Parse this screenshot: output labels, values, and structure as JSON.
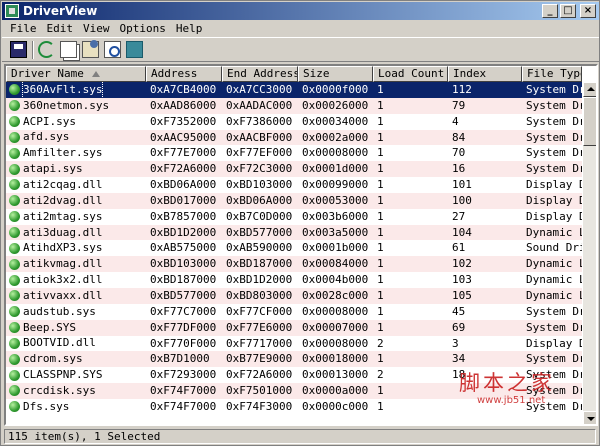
{
  "window": {
    "title": "DriverView"
  },
  "menu": [
    "File",
    "Edit",
    "View",
    "Options",
    "Help"
  ],
  "toolbar": {
    "buttons": [
      {
        "name": "save-icon"
      },
      {
        "name": "refresh-icon"
      },
      {
        "name": "copy-icon"
      },
      {
        "name": "properties-icon"
      },
      {
        "name": "find-icon"
      },
      {
        "name": "exit-icon"
      }
    ]
  },
  "columns": [
    "Driver Name",
    "Address",
    "End Address",
    "Size",
    "Load Count",
    "Index",
    "File Type"
  ],
  "rows": [
    {
      "name": "360AvFlt.sys",
      "address": "0xA7CB4000",
      "end": "0xA7CC3000",
      "size": "0x0000f000",
      "load": "1",
      "index": "112",
      "type": "System Dri",
      "selected": true
    },
    {
      "name": "360netmon.sys",
      "address": "0xAAD86000",
      "end": "0xAADAC000",
      "size": "0x00026000",
      "load": "1",
      "index": "79",
      "type": "System Dri"
    },
    {
      "name": "ACPI.sys",
      "address": "0xF7352000",
      "end": "0xF7386000",
      "size": "0x00034000",
      "load": "1",
      "index": "4",
      "type": "System Dri"
    },
    {
      "name": "afd.sys",
      "address": "0xAAC95000",
      "end": "0xAACBF000",
      "size": "0x0002a000",
      "load": "1",
      "index": "84",
      "type": "System Dri"
    },
    {
      "name": "Amfilter.sys",
      "address": "0xF77E7000",
      "end": "0xF77EF000",
      "size": "0x00008000",
      "load": "1",
      "index": "70",
      "type": "System Dri"
    },
    {
      "name": "atapi.sys",
      "address": "0xF72A6000",
      "end": "0xF72C3000",
      "size": "0x0001d000",
      "load": "1",
      "index": "16",
      "type": "System Dri"
    },
    {
      "name": "ati2cqag.dll",
      "address": "0xBD06A000",
      "end": "0xBD103000",
      "size": "0x00099000",
      "load": "1",
      "index": "101",
      "type": "Display Dr"
    },
    {
      "name": "ati2dvag.dll",
      "address": "0xBD017000",
      "end": "0xBD06A000",
      "size": "0x00053000",
      "load": "1",
      "index": "100",
      "type": "Display Dr"
    },
    {
      "name": "ati2mtag.sys",
      "address": "0xB7857000",
      "end": "0xB7C0D000",
      "size": "0x003b6000",
      "load": "1",
      "index": "27",
      "type": "Display Dr"
    },
    {
      "name": "ati3duag.dll",
      "address": "0xBD1D2000",
      "end": "0xBD577000",
      "size": "0x003a5000",
      "load": "1",
      "index": "104",
      "type": "Dynamic Li"
    },
    {
      "name": "AtihdXP3.sys",
      "address": "0xAB575000",
      "end": "0xAB590000",
      "size": "0x0001b000",
      "load": "1",
      "index": "61",
      "type": "Sound Driv"
    },
    {
      "name": "atikvmag.dll",
      "address": "0xBD103000",
      "end": "0xBD187000",
      "size": "0x00084000",
      "load": "1",
      "index": "102",
      "type": "Dynamic Li"
    },
    {
      "name": "atiok3x2.dll",
      "address": "0xBD187000",
      "end": "0xBD1D2000",
      "size": "0x0004b000",
      "load": "1",
      "index": "103",
      "type": "Dynamic Li"
    },
    {
      "name": "ativvaxx.dll",
      "address": "0xBD577000",
      "end": "0xBD803000",
      "size": "0x0028c000",
      "load": "1",
      "index": "105",
      "type": "Dynamic Li"
    },
    {
      "name": "audstub.sys",
      "address": "0xF77C7000",
      "end": "0xF77CF000",
      "size": "0x00008000",
      "load": "1",
      "index": "45",
      "type": "System Dri"
    },
    {
      "name": "Beep.SYS",
      "address": "0xF77DF000",
      "end": "0xF77E6000",
      "size": "0x00007000",
      "load": "1",
      "index": "69",
      "type": "System Dri"
    },
    {
      "name": "BOOTVID.dll",
      "address": "0xF770F000",
      "end": "0xF7717000",
      "size": "0x00008000",
      "load": "2",
      "index": "3",
      "type": "Display Dr"
    },
    {
      "name": "cdrom.sys",
      "address": "0xB7D1000",
      "end": "0xB77E9000",
      "size": "0x00018000",
      "load": "1",
      "index": "34",
      "type": "System Dri"
    },
    {
      "name": "CLASSPNP.SYS",
      "address": "0xF7293000",
      "end": "0xF72A6000",
      "size": "0x00013000",
      "load": "2",
      "index": "18",
      "type": "System Dri"
    },
    {
      "name": "crcdisk.sys",
      "address": "0xF74F7000",
      "end": "0xF7501000",
      "size": "0x0000a000",
      "load": "1",
      "index": "",
      "type": "System Dri"
    },
    {
      "name": "Dfs.sys",
      "address": "0xF74F7000",
      "end": "0xF74F3000",
      "size": "0x0000c000",
      "load": "1",
      "index": "",
      "type": "System Dri"
    }
  ],
  "status": {
    "text": "115 item(s), 1 Selected"
  },
  "watermark": {
    "title": "脚本之家",
    "url": "www.jb51.net"
  }
}
